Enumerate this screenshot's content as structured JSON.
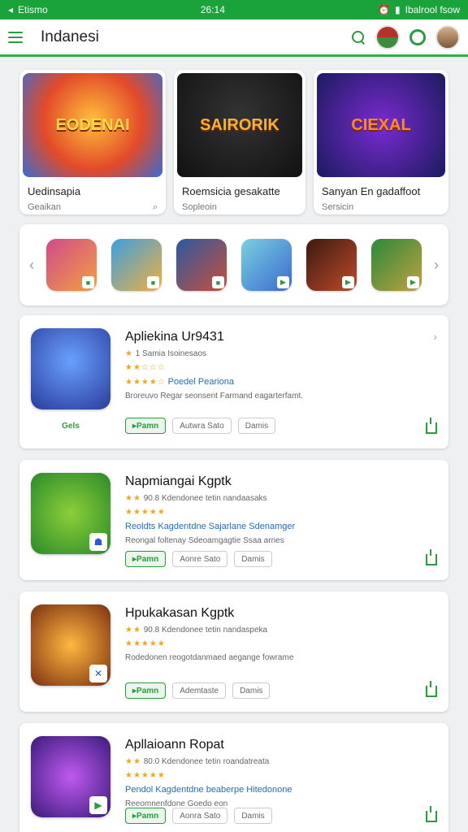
{
  "status": {
    "left": "Etismo",
    "center": "26:14",
    "right": "Ibalrool fsow"
  },
  "header": {
    "title": "Indanesi"
  },
  "featured": [
    {
      "art": "EODENAI",
      "title": "Uedinsapia",
      "sub": "Geaikan"
    },
    {
      "art": "SAIRORIK",
      "title": "Roemsicia gesakatte",
      "sub": "Sopleoin"
    },
    {
      "art": "CIEXAL",
      "title": "Sanyan En gadaffoot",
      "sub": "Sersicin"
    }
  ],
  "strip": {
    "tiles": [
      "tile1",
      "tile2",
      "tile3",
      "tile4",
      "tile5",
      "tile6"
    ]
  },
  "apps": [
    {
      "name": "Apliekina Ur9431",
      "line1": "1 Samia Isoinesaos",
      "rating": "Poedel Peariona",
      "line3": "Broreuvo Regar seonsent Farmand eagarterfamt.",
      "cap": "Gels",
      "btn1": "Pamn",
      "btn2": "Autwra Sato",
      "btn3": "Damis"
    },
    {
      "name": "Napmiangai Kgptk",
      "line1": "90.8 Kdendonee tetin nandaasaks",
      "rating": "Reoldts Kagdentdne Sajarlane Sdenamger",
      "line3": "Reongal foltenay Sdeoamgagtie Ssaa arnes",
      "cap": "",
      "btn1": "Pamn",
      "btn2": "Aonre Sato",
      "btn3": "Damis"
    },
    {
      "name": "Hpukakasan Kgptk",
      "line1": "90.8 Kdendonee tetin nandaspeka",
      "rating": "",
      "line3": "Rodedonen reogotdanmaed aegange fowrame",
      "cap": "",
      "btn1": "Pamn",
      "btn2": "Ademtaste",
      "btn3": "Damis"
    },
    {
      "name": "Apllaioann Ropat",
      "line1": "80.0 Kdendonee tetin roandatreata",
      "rating": "Pendol Kagdentdne beaberpe Hitedonone",
      "line3": "Reeomnenfdone Goedo eon",
      "cap": "",
      "btn1": "Pamn",
      "btn2": "Aonra Sato",
      "btn3": "Damis"
    }
  ]
}
